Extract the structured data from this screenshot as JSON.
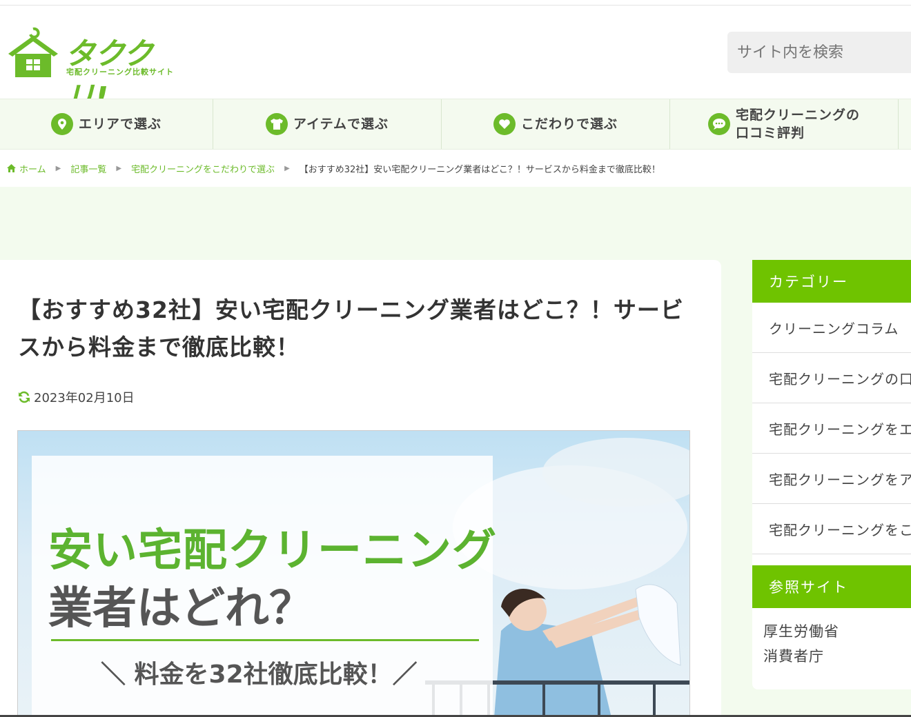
{
  "logo": {
    "title": "タククリ!",
    "subtitle": "宅配クリーニング比較サイト"
  },
  "search": {
    "placeholder": "サイト内を検索"
  },
  "nav": [
    {
      "label": "エリアで選ぶ",
      "icon": "map-pin-icon"
    },
    {
      "label": "アイテムで選ぶ",
      "icon": "shirt-icon"
    },
    {
      "label": "こだわりで選ぶ",
      "icon": "heart-icon"
    },
    {
      "label": "宅配クリーニングの\n口コミ評判",
      "icon": "speech-bubble-icon"
    }
  ],
  "breadcrumb": {
    "home": "ホーム",
    "list": "記事一覧",
    "category": "宅配クリーニングをこだわりで選ぶ",
    "current": "【おすすめ32社】安い宅配クリーニング業者はどこ？！サービスから料金まで徹底比較！"
  },
  "article": {
    "title": "【おすすめ32社】安い宅配クリーニング業者はどこ？！サービスから料金まで徹底比較！",
    "date": "2023年02月10日",
    "hero": {
      "line1": "安い宅配クリーニング",
      "line2": "業者はどれ？",
      "line3": "＼ 料金を32社徹底比較！／"
    }
  },
  "sidebar": {
    "category_heading": "カテゴリー",
    "categories": [
      "クリーニングコラム",
      "宅配クリーニングの口コミ評判",
      "宅配クリーニングをエリアで選ぶ",
      "宅配クリーニングをアイテムで選ぶ",
      "宅配クリーニングをこだわりで選ぶ"
    ],
    "reference_heading": "参照サイト",
    "references": [
      "厚生労働省",
      "消費者庁"
    ]
  },
  "colors": {
    "brand": "#6cbb2a",
    "sidebar_head": "#6fc300",
    "band": "#f3fbee"
  }
}
